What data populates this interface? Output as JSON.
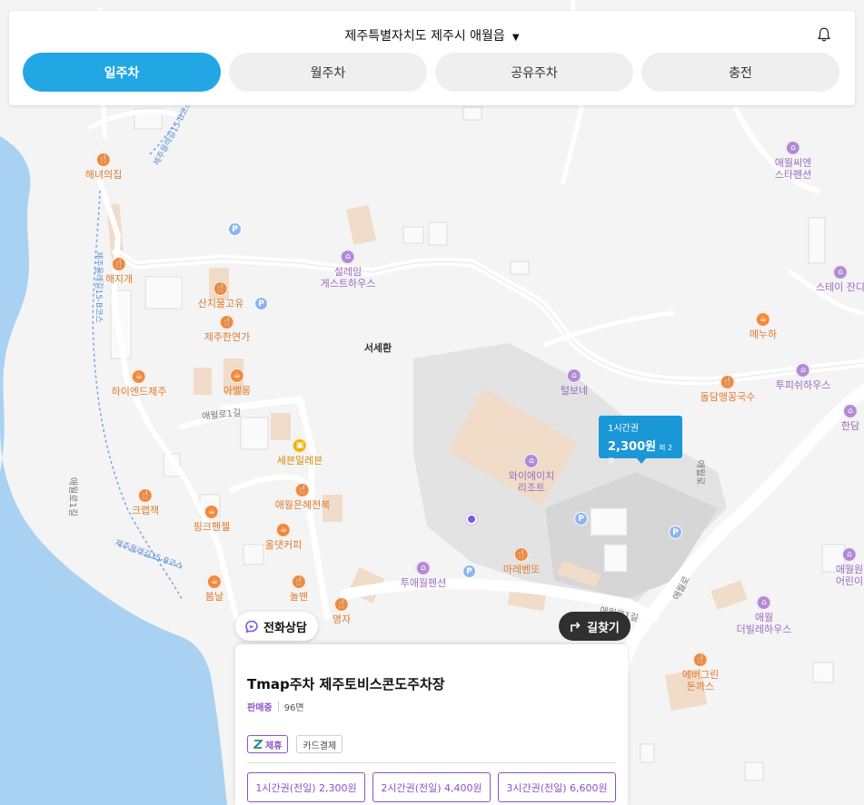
{
  "header": {
    "location": "제주특별자치도 제주시 애월읍",
    "caret_icon": "caret-down-icon",
    "bell_icon": "bell-icon",
    "tabs": [
      {
        "label": "일주차",
        "active": true
      },
      {
        "label": "월주차",
        "active": false
      },
      {
        "label": "공유주차",
        "active": false
      },
      {
        "label": "충전",
        "active": false
      }
    ]
  },
  "map": {
    "pois": [
      {
        "name": "해녀의집",
        "kind": "food"
      },
      {
        "name": "해지개",
        "kind": "food"
      },
      {
        "name": "산지물고유",
        "kind": "food"
      },
      {
        "name": "제주한연가",
        "kind": "food"
      },
      {
        "name": "하이엔드제주",
        "kind": "cafe"
      },
      {
        "name": "아벨롱",
        "kind": "cafe"
      },
      {
        "name": "설레임\n게스트하우스",
        "kind": "lodge"
      },
      {
        "name": "서세환",
        "kind": "plain"
      },
      {
        "name": "애월씨엔\n스타펜션",
        "kind": "lodge"
      },
      {
        "name": "스테이 잔디",
        "kind": "lodge"
      },
      {
        "name": "메누하",
        "kind": "cafe"
      },
      {
        "name": "털보네",
        "kind": "lodge"
      },
      {
        "name": "돌담맹꽁국수",
        "kind": "food"
      },
      {
        "name": "투피쉬하우스",
        "kind": "lodge"
      },
      {
        "name": "한담",
        "kind": "lodge"
      },
      {
        "name": "세븐일레븐",
        "kind": "shop"
      },
      {
        "name": "애월은혜전복",
        "kind": "food"
      },
      {
        "name": "와이에이치\n리조트",
        "kind": "lodge"
      },
      {
        "name": "크랩잭",
        "kind": "food"
      },
      {
        "name": "핑크헨젤",
        "kind": "cafe"
      },
      {
        "name": "올댓커피",
        "kind": "cafe"
      },
      {
        "name": "마레벤또",
        "kind": "food"
      },
      {
        "name": "투애월펜션",
        "kind": "lodge"
      },
      {
        "name": "봄날",
        "kind": "cafe"
      },
      {
        "name": "놀맨",
        "kind": "food"
      },
      {
        "name": "명자",
        "kind": "food"
      },
      {
        "name": "애월원\n어린이",
        "kind": "lodge"
      },
      {
        "name": "애월\n더빌레하우스",
        "kind": "lodge"
      },
      {
        "name": "에버그린\n돈까스",
        "kind": "food"
      }
    ],
    "road_labels": [
      "애월로1길",
      "애월로1길",
      "애월로",
      "애월로",
      "애월로1길"
    ],
    "trail_label": "제주올레길15-B코스",
    "parking_symbol": "P",
    "price_bubble": {
      "title": "1시간권",
      "price": "2,300원",
      "extra": "외 2종"
    }
  },
  "buttons": {
    "call_label": "전화상담",
    "call_icon": "phone-chat-icon",
    "route_label": "길찾기",
    "route_icon": "turn-right-arrow-icon"
  },
  "lot": {
    "name": "Tmap주차 제주토비스콘도주차장",
    "status": "판매중",
    "spaces": "96면",
    "badges": {
      "partner": "제휴",
      "card": "카드결제"
    },
    "tickets": [
      "1시간권(전일) 2,300원",
      "2시간권(전일) 4,400원",
      "3시간권(전일) 6,600원"
    ]
  },
  "colors": {
    "accent": "#22a7e4",
    "purple": "#8d53c7",
    "sea": "#a9d2f2",
    "bubble": "#1a97d6"
  }
}
